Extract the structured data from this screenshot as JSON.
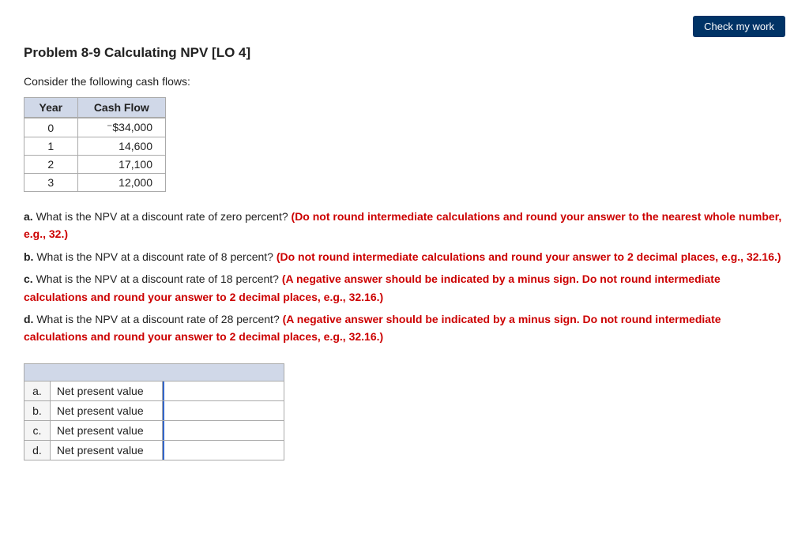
{
  "header": {
    "check_button_label": "Check my work"
  },
  "problem": {
    "title": "Problem 8-9 Calculating NPV [LO 4]",
    "intro": "Consider the following cash flows:",
    "cash_flow_table": {
      "headers": [
        "Year",
        "Cash Flow"
      ],
      "rows": [
        {
          "year": "0",
          "value": "⁻$34,000"
        },
        {
          "year": "1",
          "value": "14,600"
        },
        {
          "year": "2",
          "value": "17,100"
        },
        {
          "year": "3",
          "value": "12,000"
        }
      ]
    },
    "questions": [
      {
        "label": "a.",
        "text": "What is the NPV at a discount rate of zero percent?",
        "note": "(Do not round intermediate calculations and round your answer to the nearest whole number, e.g., 32.)"
      },
      {
        "label": "b.",
        "text": "What is the NPV at a discount rate of 8 percent?",
        "note": "(Do not round intermediate calculations and round your answer to 2 decimal places, e.g., 32.16.)"
      },
      {
        "label": "c.",
        "text": "What is the NPV at a discount rate of 18 percent?",
        "note": "(A negative answer should be indicated by a minus sign. Do not round intermediate calculations and round your answer to 2 decimal places, e.g., 32.16.)"
      },
      {
        "label": "d.",
        "text": "What is the NPV at a discount rate of 28 percent?",
        "note": "(A negative answer should be indicated by a minus sign. Do not round intermediate calculations and round your answer to 2 decimal places, e.g., 32.16.)"
      }
    ],
    "answer_table": {
      "rows": [
        {
          "label": "a.",
          "field": "Net present value",
          "value": ""
        },
        {
          "label": "b.",
          "field": "Net present value",
          "value": ""
        },
        {
          "label": "c.",
          "field": "Net present value",
          "value": ""
        },
        {
          "label": "d.",
          "field": "Net present value",
          "value": ""
        }
      ]
    }
  }
}
